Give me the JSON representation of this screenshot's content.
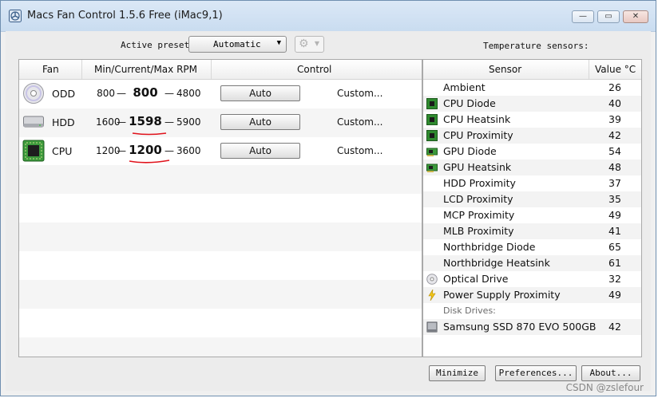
{
  "window": {
    "title": "Macs Fan Control 1.5.6 Free (iMac9,1)",
    "minimize_glyph": "—",
    "maximize_glyph": "▭",
    "close_glyph": "✕"
  },
  "toolbar": {
    "preset_label": "Active preset:",
    "preset_value": "Automatic",
    "preset_arrow": "▼",
    "gear_glyph": "⚙",
    "gear_arrow": "▼",
    "temp_title": "Temperature sensors:"
  },
  "fans": {
    "headers": {
      "fan": "Fan",
      "rpm": "Min/Current/Max RPM",
      "control": "Control"
    },
    "dash": "—",
    "rows": [
      {
        "icon": "optical-drive-icon",
        "name": "ODD",
        "min": "800",
        "current": "800",
        "max": "4800",
        "control": "Auto",
        "custom": "Custom..."
      },
      {
        "icon": "hard-drive-icon",
        "name": "HDD",
        "min": "1600",
        "current": "1598",
        "max": "5900",
        "control": "Auto",
        "custom": "Custom..."
      },
      {
        "icon": "cpu-chip-icon",
        "name": "CPU",
        "min": "1200",
        "current": "1200",
        "max": "3600",
        "control": "Auto",
        "custom": "Custom..."
      }
    ]
  },
  "sensors": {
    "headers": {
      "sensor": "Sensor",
      "value": "Value °C"
    },
    "rows": [
      {
        "icon": "none",
        "name": "Ambient",
        "value": "26"
      },
      {
        "icon": "chip-icon",
        "name": "CPU Diode",
        "value": "40"
      },
      {
        "icon": "chip-icon",
        "name": "CPU Heatsink",
        "value": "39"
      },
      {
        "icon": "chip-icon",
        "name": "CPU Proximity",
        "value": "42"
      },
      {
        "icon": "gpu-card-icon",
        "name": "GPU Diode",
        "value": "54"
      },
      {
        "icon": "gpu-card-icon",
        "name": "GPU Heatsink",
        "value": "48"
      },
      {
        "icon": "none",
        "name": "HDD Proximity",
        "value": "37"
      },
      {
        "icon": "none",
        "name": "LCD Proximity",
        "value": "35"
      },
      {
        "icon": "none",
        "name": "MCP Proximity",
        "value": "49"
      },
      {
        "icon": "none",
        "name": "MLB Proximity",
        "value": "41"
      },
      {
        "icon": "none",
        "name": "Northbridge Diode",
        "value": "65"
      },
      {
        "icon": "none",
        "name": "Northbridge Heatsink",
        "value": "61"
      },
      {
        "icon": "optical-disc-icon",
        "name": "Optical Drive",
        "value": "32"
      },
      {
        "icon": "lightning-icon",
        "name": "Power Supply Proximity",
        "value": "49"
      }
    ],
    "group_label": "Disk Drives:",
    "disk": {
      "icon": "ssd-icon",
      "name": "Samsung SSD 870 EVO 500GB",
      "value": "42"
    }
  },
  "buttons": {
    "minimize": "Minimize",
    "preferences": "Preferences...",
    "about": "About..."
  },
  "watermark": "CSDN @zslefour",
  "colors": {
    "annotation_red": "#e0121b",
    "chip_green": "#2f8a2f"
  }
}
